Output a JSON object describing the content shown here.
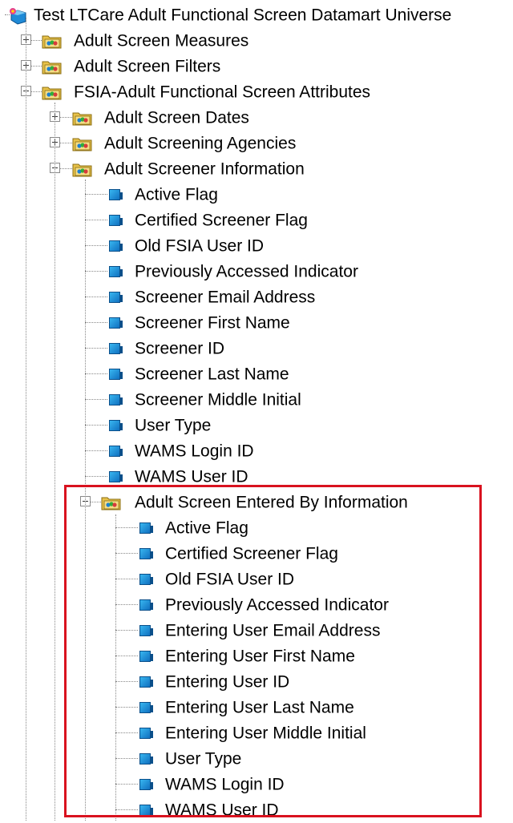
{
  "tree": {
    "root": {
      "label": "Test LTCare Adult Functional Screen Datamart Universe",
      "icon": "universe-icon"
    },
    "nodes": [
      {
        "label": "Adult Screen Measures",
        "icon": "folder-icon",
        "toggle": "plus"
      },
      {
        "label": "Adult Screen Filters",
        "icon": "folder-icon",
        "toggle": "plus"
      },
      {
        "label": "FSIA-Adult Functional Screen Attributes",
        "icon": "folder-icon",
        "toggle": "minus"
      },
      {
        "label": "Adult Screen Dates",
        "icon": "folder-icon",
        "toggle": "plus"
      },
      {
        "label": "Adult Screening Agencies",
        "icon": "folder-icon",
        "toggle": "plus"
      },
      {
        "label": "Adult Screener Information",
        "icon": "folder-icon",
        "toggle": "minus"
      },
      {
        "label": "Adult Screen Entered By Information",
        "icon": "folder-icon",
        "toggle": "minus"
      }
    ],
    "screener_fields": [
      "Active Flag",
      "Certified Screener Flag",
      "Old FSIA User ID",
      "Previously Accessed Indicator",
      "Screener Email Address",
      "Screener First Name",
      "Screener ID",
      "Screener Last Name",
      "Screener Middle Initial",
      "User Type",
      "WAMS Login ID",
      "WAMS User ID"
    ],
    "entered_by_fields": [
      "Active Flag",
      "Certified Screener Flag",
      "Old FSIA User ID",
      "Previously Accessed Indicator",
      "Entering User Email Address",
      "Entering User First Name",
      "Entering User ID",
      "Entering User Last Name",
      "Entering User Middle Initial",
      "User Type",
      "WAMS Login ID",
      "WAMS User ID"
    ]
  },
  "colors": {
    "highlight_border": "#d9121f",
    "field_icon": "#1f8ad6",
    "folder_icon": "#e8c24a"
  }
}
